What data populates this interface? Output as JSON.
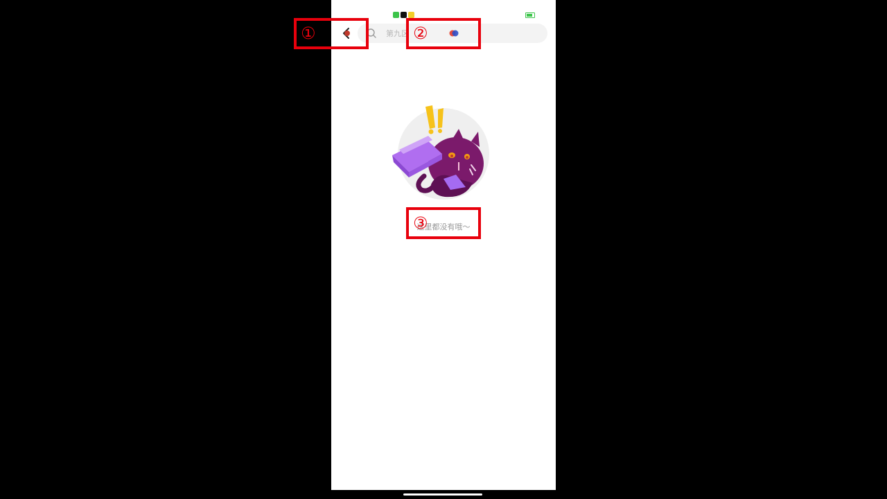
{
  "status_bar": {
    "icons": [
      "green-app-icon",
      "tiktok-icon",
      "yellow-app-icon"
    ],
    "battery_color": "#3cc44a"
  },
  "search": {
    "placeholder": "第九区"
  },
  "empty_state": {
    "message": "这里都没有哦～"
  },
  "annotations": [
    {
      "label": "①",
      "target": "back-button"
    },
    {
      "label": "②",
      "target": "search-bar"
    },
    {
      "label": "③",
      "target": "empty-state-text"
    }
  ],
  "colors": {
    "annotation": "#e8000c",
    "background": "#000000",
    "screen": "#ffffff"
  }
}
